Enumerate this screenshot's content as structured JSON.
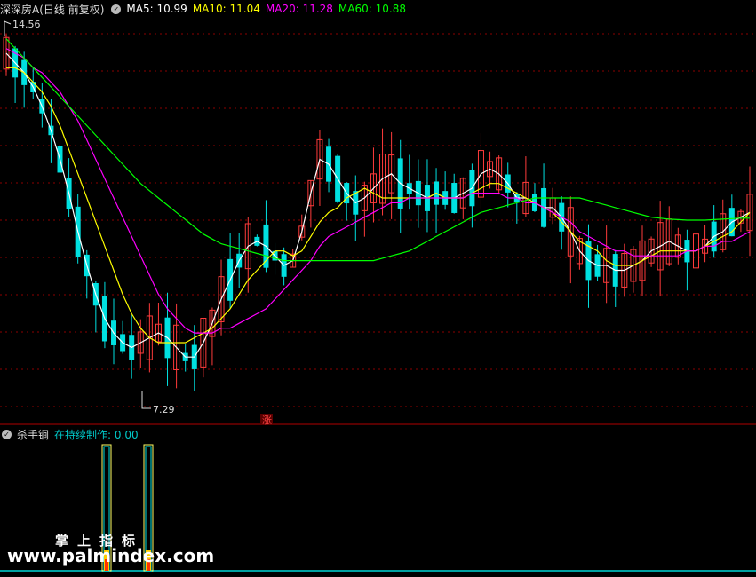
{
  "header": {
    "stock_name": "深深房A",
    "period": "(日线 前复权)",
    "ma5": "MA5: 10.99",
    "ma10": "MA10: 11.04",
    "ma20": "MA20: 11.28",
    "ma60": "MA60: 10.88"
  },
  "indicator": {
    "name": "杀手锏",
    "label": "在持续制作: 0.00"
  },
  "price_high_label": "14.56",
  "price_low_label": "7.29",
  "zhang_tag": "涨",
  "watermark": {
    "line1": "掌上指标",
    "line2": "www.palmindex.com"
  },
  "colors": {
    "background": "#000000",
    "up": "#ff3b3b",
    "down": "#00e0e0",
    "ma5": "#ffffff",
    "ma10": "#ffff00",
    "ma20": "#ff00ff",
    "ma60": "#00ff00",
    "grid": "#8b0000"
  },
  "chart_data": {
    "type": "candlestick",
    "ylim": [
      6.9,
      15.0
    ],
    "series": [
      {
        "name": "MA5",
        "values": [
          14.3,
          14.1,
          13.9,
          13.6,
          13.2,
          12.7,
          12.1,
          11.4,
          10.6,
          9.9,
          9.3,
          8.8,
          8.5,
          8.3,
          8.2,
          8.3,
          8.4,
          8.5,
          8.4,
          8.2,
          8.0,
          8.0,
          8.3,
          8.7,
          9.2,
          9.6,
          10.0,
          10.3,
          10.4,
          10.3,
          10.1,
          9.9,
          10.0,
          10.6,
          11.4,
          12.1,
          12.0,
          11.7,
          11.4,
          11.2,
          11.3,
          11.5,
          11.7,
          11.8,
          11.6,
          11.5,
          11.4,
          11.3,
          11.4,
          11.3,
          11.3,
          11.4,
          11.5,
          11.8,
          11.9,
          11.8,
          11.6,
          11.3,
          11.3,
          11.2,
          11.1,
          11.1,
          10.9,
          10.6,
          10.2,
          10.0,
          9.9,
          9.9,
          9.8,
          9.8,
          9.9,
          10.0,
          10.2,
          10.3,
          10.4,
          10.3,
          10.2,
          10.2,
          10.3,
          10.5,
          10.6,
          10.8,
          10.9,
          11.0
        ]
      },
      {
        "name": "MA10",
        "values": [
          14.0,
          14.0,
          13.9,
          13.7,
          13.5,
          13.2,
          12.8,
          12.3,
          11.8,
          11.3,
          10.8,
          10.3,
          9.8,
          9.3,
          8.9,
          8.6,
          8.4,
          8.3,
          8.3,
          8.3,
          8.3,
          8.4,
          8.5,
          8.6,
          8.8,
          9.0,
          9.3,
          9.6,
          9.8,
          10.0,
          10.2,
          10.2,
          10.1,
          10.2,
          10.5,
          10.8,
          11.0,
          11.1,
          11.3,
          11.4,
          11.5,
          11.4,
          11.3,
          11.3,
          11.3,
          11.3,
          11.3,
          11.3,
          11.4,
          11.3,
          11.3,
          11.3,
          11.4,
          11.5,
          11.6,
          11.6,
          11.5,
          11.4,
          11.3,
          11.2,
          11.1,
          11.0,
          10.8,
          10.6,
          10.4,
          10.3,
          10.2,
          10.0,
          9.9,
          9.9,
          9.9,
          10.0,
          10.1,
          10.2,
          10.2,
          10.2,
          10.2,
          10.2,
          10.3,
          10.4,
          10.5,
          10.6,
          10.8,
          11.0
        ]
      },
      {
        "name": "MA20",
        "values": [
          14.4,
          14.3,
          14.2,
          14.0,
          13.9,
          13.7,
          13.5,
          13.2,
          12.9,
          12.5,
          12.1,
          11.7,
          11.3,
          10.9,
          10.5,
          10.1,
          9.7,
          9.3,
          9.0,
          8.8,
          8.6,
          8.5,
          8.5,
          8.5,
          8.6,
          8.6,
          8.7,
          8.8,
          8.9,
          9.0,
          9.2,
          9.4,
          9.6,
          9.8,
          10.0,
          10.3,
          10.5,
          10.6,
          10.7,
          10.8,
          10.9,
          11.0,
          11.1,
          11.2,
          11.2,
          11.3,
          11.3,
          11.3,
          11.3,
          11.3,
          11.3,
          11.3,
          11.4,
          11.4,
          11.4,
          11.4,
          11.3,
          11.3,
          11.2,
          11.2,
          11.1,
          11.0,
          10.9,
          10.8,
          10.6,
          10.5,
          10.4,
          10.3,
          10.2,
          10.2,
          10.1,
          10.1,
          10.1,
          10.1,
          10.1,
          10.1,
          10.2,
          10.2,
          10.3,
          10.3,
          10.4,
          10.4,
          10.5,
          10.6
        ]
      },
      {
        "name": "MA60",
        "values": [
          14.6,
          14.4,
          14.2,
          14.0,
          13.8,
          13.6,
          13.4,
          13.2,
          13.0,
          12.8,
          12.6,
          12.4,
          12.2,
          12.0,
          11.8,
          11.6,
          11.45,
          11.3,
          11.15,
          11.0,
          10.85,
          10.7,
          10.55,
          10.45,
          10.35,
          10.3,
          10.25,
          10.2,
          10.15,
          10.1,
          10.05,
          10.0,
          10.0,
          10.0,
          10.0,
          10.0,
          10.0,
          10.0,
          10.0,
          10.0,
          10.0,
          10.0,
          10.05,
          10.1,
          10.15,
          10.2,
          10.3,
          10.4,
          10.5,
          10.6,
          10.7,
          10.8,
          10.9,
          11.0,
          11.05,
          11.1,
          11.15,
          11.2,
          11.25,
          11.3,
          11.3,
          11.3,
          11.3,
          11.3,
          11.3,
          11.25,
          11.2,
          11.15,
          11.1,
          11.05,
          11.0,
          10.95,
          10.9,
          10.88,
          10.86,
          10.85,
          10.84,
          10.84,
          10.84,
          10.85,
          10.86,
          10.87,
          10.88,
          10.88
        ]
      }
    ]
  }
}
